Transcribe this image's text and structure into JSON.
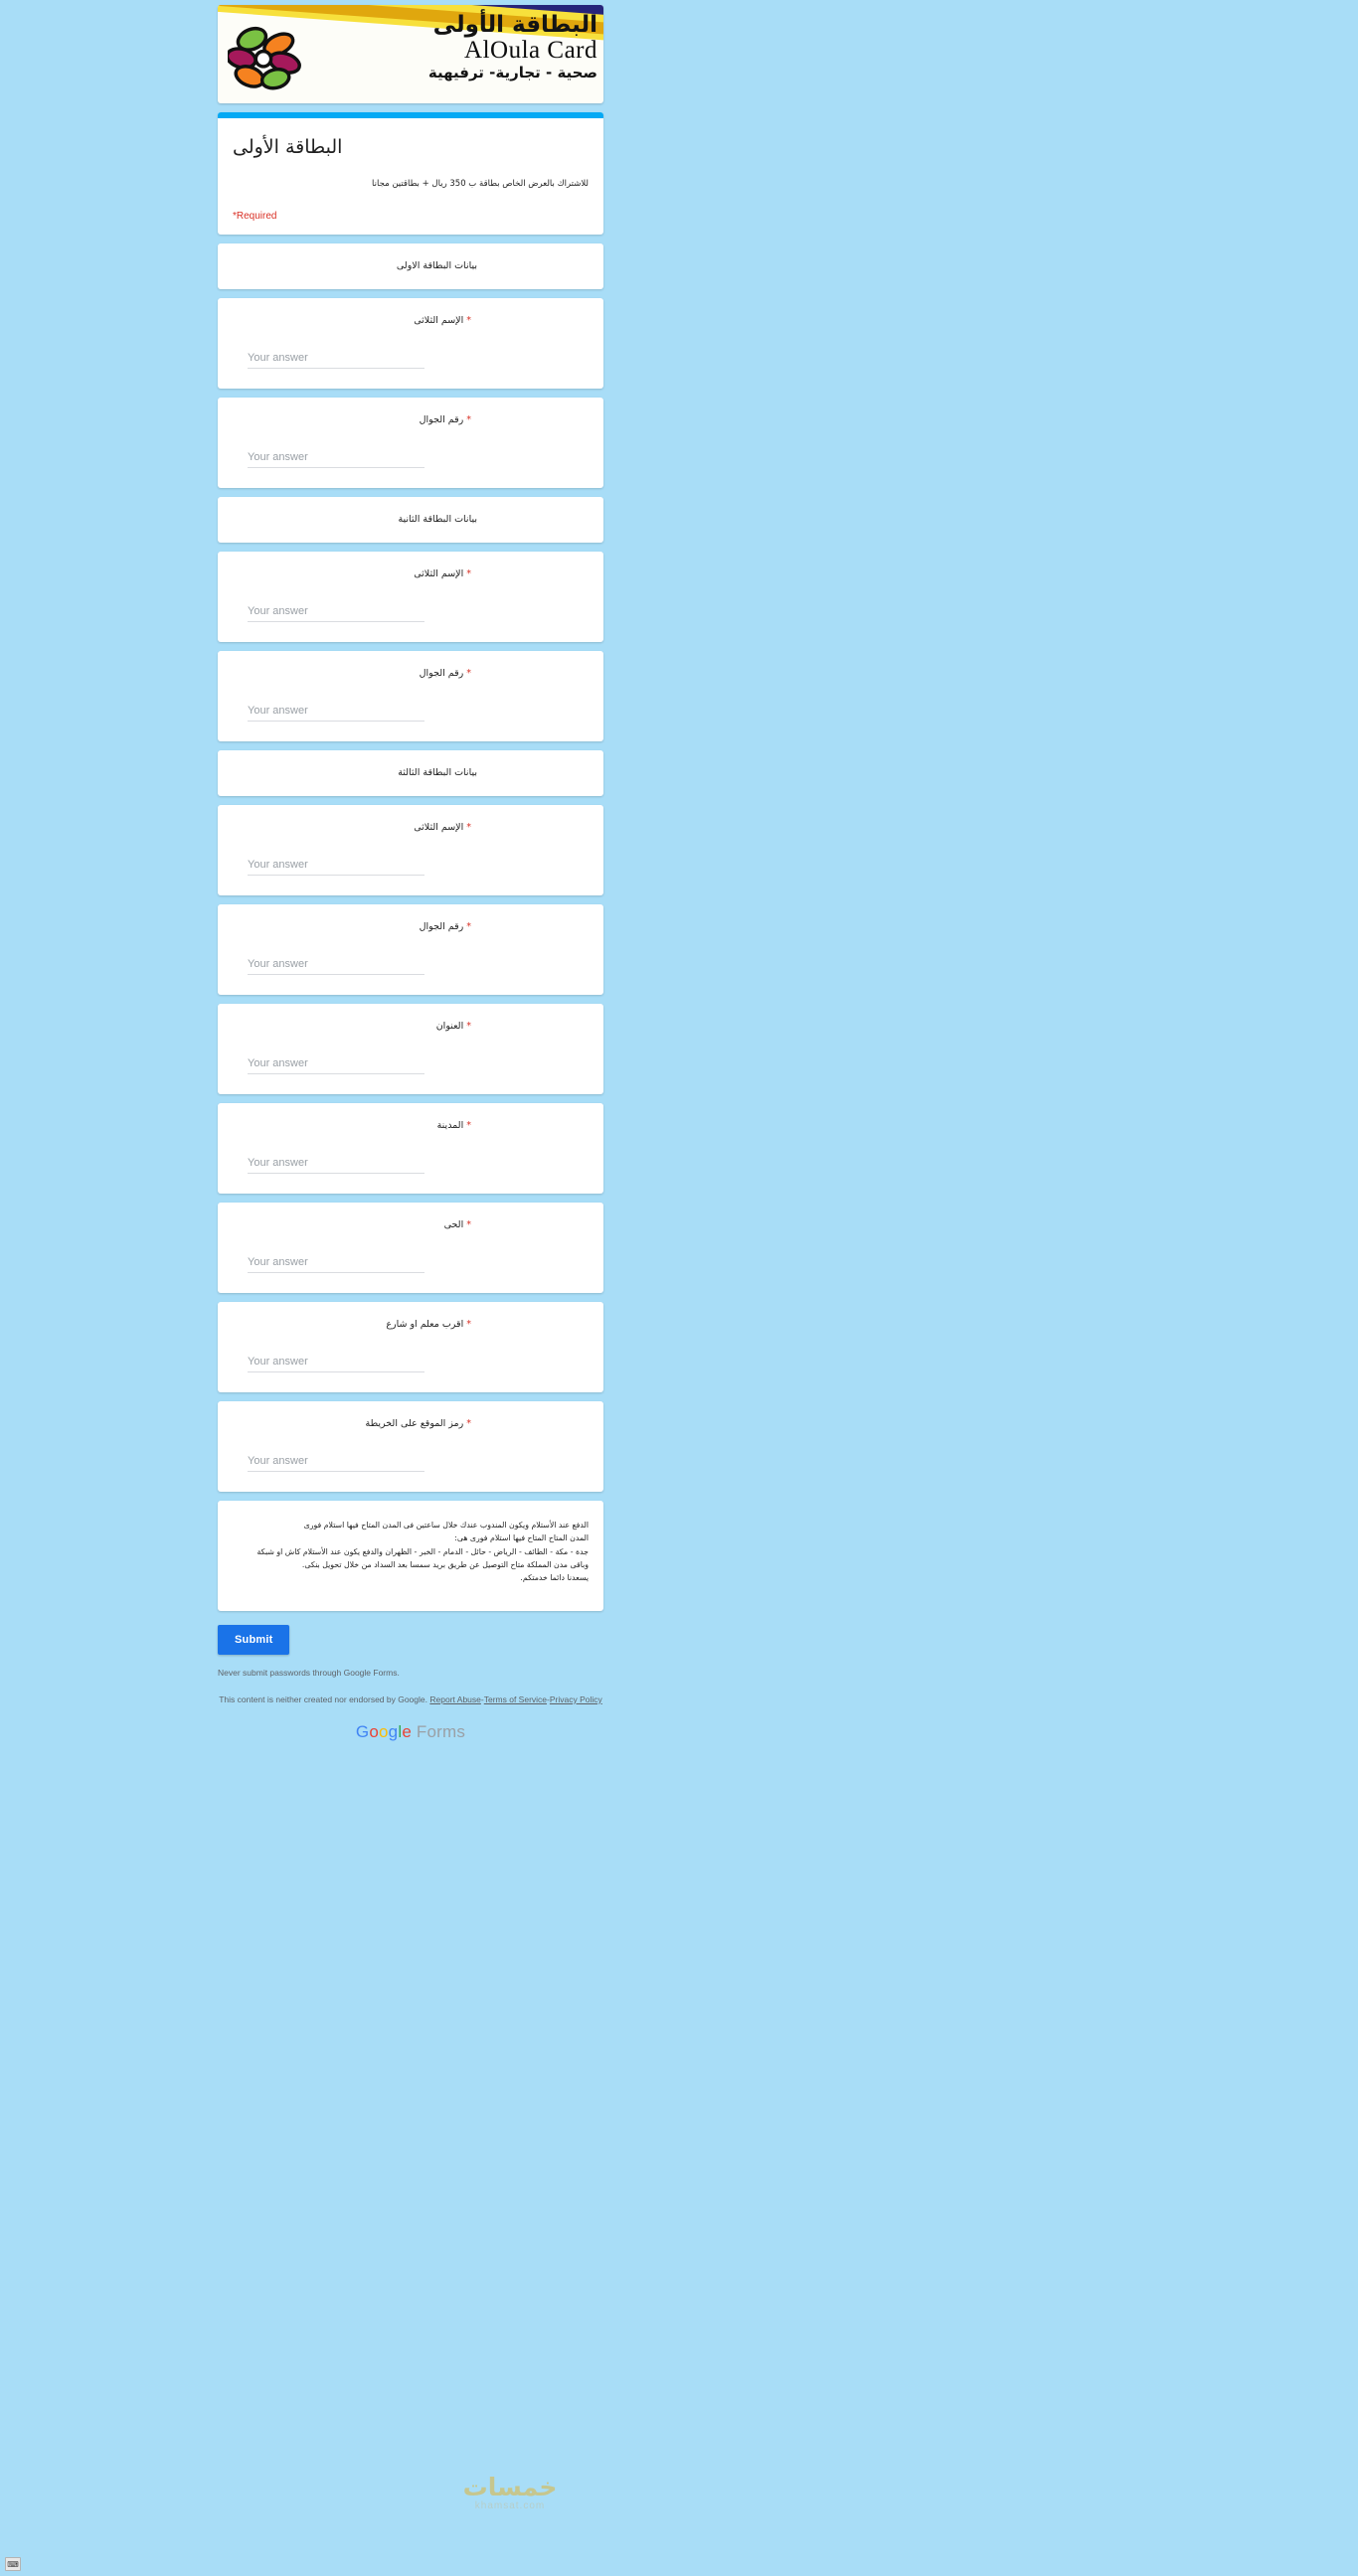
{
  "banner": {
    "arabic_title": "البطاقة الأولى",
    "latin_title": "AlOula Card",
    "arabic_subtitle": "صحية - تجارية- ترفيهية",
    "logo_icon": "flower-logo-icon",
    "colors": {
      "yellow_stripe": "#f7e03c",
      "gold_stripe": "#e0a70e",
      "navy_stripe": "#26247a",
      "purple_stripe": "#3b1d6e",
      "petal_green": "#7ac143",
      "petal_orange": "#f58220",
      "petal_magenta": "#a5195b"
    }
  },
  "form": {
    "accent_color": "#03a9f4",
    "title": "البطاقة الأولى",
    "description": "للاشتراك بالعرض الخاص بطاقة ب 350 ريال + بطاقتين مجانا",
    "required_note": "*Required",
    "answer_placeholder": "Your answer"
  },
  "sections": [
    {
      "label": "بيانات البطاقة الاولى"
    },
    {
      "label": "بيانات البطاقة الثانية"
    },
    {
      "label": "بيانات البطاقة الثالثة"
    }
  ],
  "questions": [
    {
      "label": "الإسم الثلاثى",
      "required": true,
      "star": "*"
    },
    {
      "label": "رقم الجوال",
      "required": true,
      "star": "*"
    },
    {
      "label": "الإسم الثلاثى",
      "required": true,
      "star": "*"
    },
    {
      "label": "رقم الجوال",
      "required": true,
      "star": "*"
    },
    {
      "label": "الإسم الثلاثى",
      "required": true,
      "star": "*"
    },
    {
      "label": "رقم الجوال",
      "required": true,
      "star": "*"
    },
    {
      "label": "العنوان",
      "required": true,
      "star": "*"
    },
    {
      "label": "المدينة",
      "required": true,
      "star": "*"
    },
    {
      "label": "الحى",
      "required": true,
      "star": "*"
    },
    {
      "label": "اقرب معلم او شارع",
      "required": true,
      "star": "*"
    },
    {
      "label": "رمز الموقع على الخريطة",
      "required": true,
      "star": "*"
    }
  ],
  "info_block": {
    "line1": "الدفع عند الأستلام ويكون المندوب عندك خلال ساعتين فى المدن المتاح فيها استلام فورى",
    "line2": "المدن المتاح المتاح فيها استلام فورى هى:",
    "line3": "جدة - مكة - الطائف - الرياض - حائل - الدمام - الخبر - الظهران والدفع يكون عند الأستلام كاش او شبكة",
    "line4": "وباقى مدن المملكة متاح التوصيل عن طريق بريد سمسا بعد السداد من خلال تحويل بنكى.",
    "line5": "يسعدنا دائما خدمتكم."
  },
  "footer": {
    "submit_label": "Submit",
    "never_submit": "Never submit passwords through Google Forms.",
    "disclaimer_prefix": "This content is neither created nor endorsed by Google.",
    "report_abuse": "Report Abuse",
    "terms": "Terms of Service",
    "privacy": "Privacy Policy",
    "separator": "-",
    "google_g": "G",
    "google_o1": "o",
    "google_o2": "o",
    "google_g2": "g",
    "google_l": "l",
    "google_e": "e",
    "forms_word": "Forms"
  },
  "watermark": {
    "main": "خمسات",
    "sub": "khamsat.com"
  },
  "taskbar": {
    "item_glyph": "⌨"
  }
}
